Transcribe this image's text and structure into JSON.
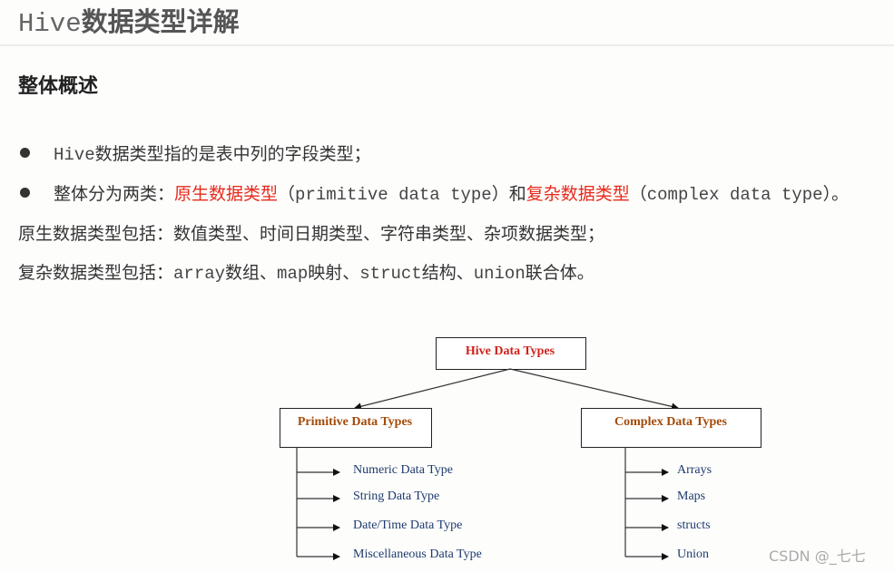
{
  "page": {
    "title_prefix": "Hive",
    "title_suffix": "数据类型详解",
    "section_title": "整体概述"
  },
  "content": {
    "bullet1": {
      "mono": "Hive",
      "text": "数据类型指的是表中列的字段类型；"
    },
    "bullet2": {
      "text_a": "整体分为两类：",
      "red_a": "原生数据类型",
      "paren_open_a": "（",
      "mono_a": "primitive data type",
      "paren_close_a": "）",
      "text_b": "和",
      "red_b": "复杂数据类型",
      "paren_open_b": "（",
      "mono_b": "complex data type",
      "paren_close_b": "）。"
    },
    "line3": "原生数据类型包括：数值类型、时间日期类型、字符串类型、杂项数据类型；",
    "line4": {
      "prefix": "复杂数据类型包括：",
      "m1": "array",
      "t1": "数组、",
      "m2": "map",
      "t2": "映射、",
      "m3": "struct",
      "t3": "结构、",
      "m4": "union",
      "t4": "联合体。"
    }
  },
  "diagram": {
    "root": {
      "label": "Hive Data Types",
      "color": "#d0211b"
    },
    "primitive": {
      "label": "Primitive Data Types",
      "color": "#a44a08",
      "children": [
        "Numeric Data Type",
        "String Data Type",
        "Date/Time Data Type",
        "Miscellaneous Data Type"
      ]
    },
    "complex": {
      "label": "Complex Data Types",
      "color": "#a44a08",
      "children": [
        "Arrays",
        "Maps",
        "structs",
        "Union"
      ]
    }
  },
  "watermark": "CSDN @_七七",
  "colors": {
    "highlight_red": "#e8291c",
    "leaf_blue": "#1f3a6e"
  }
}
